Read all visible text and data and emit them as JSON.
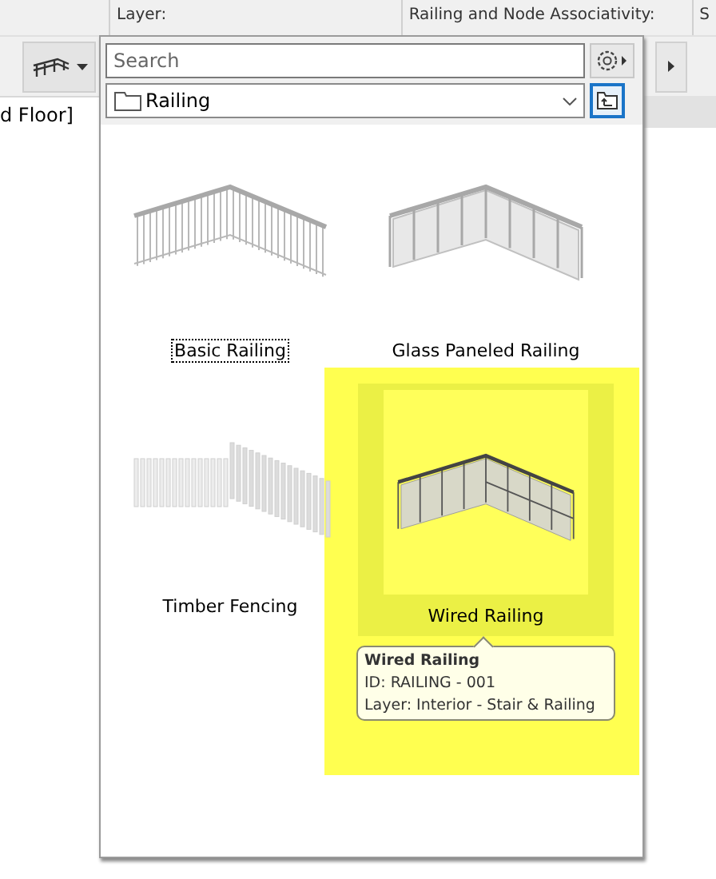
{
  "info_bar": {
    "columns": [
      "Layer:",
      "Railing and Node Associativity:",
      "S"
    ]
  },
  "floor_label": "d Floor]",
  "popup": {
    "search": {
      "placeholder": "Search"
    },
    "folder": {
      "name": "Railing"
    },
    "items": [
      {
        "name": "Basic Railing",
        "kind": "basic",
        "selected": false,
        "focused": true
      },
      {
        "name": "Glass Paneled Railing",
        "kind": "glass",
        "selected": false,
        "focused": false
      },
      {
        "name": "Timber Fencing",
        "kind": "timber",
        "selected": false,
        "focused": false
      },
      {
        "name": "Wired Railing",
        "kind": "wired",
        "selected": true,
        "focused": false
      }
    ],
    "tooltip": {
      "title": "Wired Railing",
      "id": "ID: RAILING - 001",
      "layer": "Layer: Interior - Stair & Railing"
    }
  }
}
